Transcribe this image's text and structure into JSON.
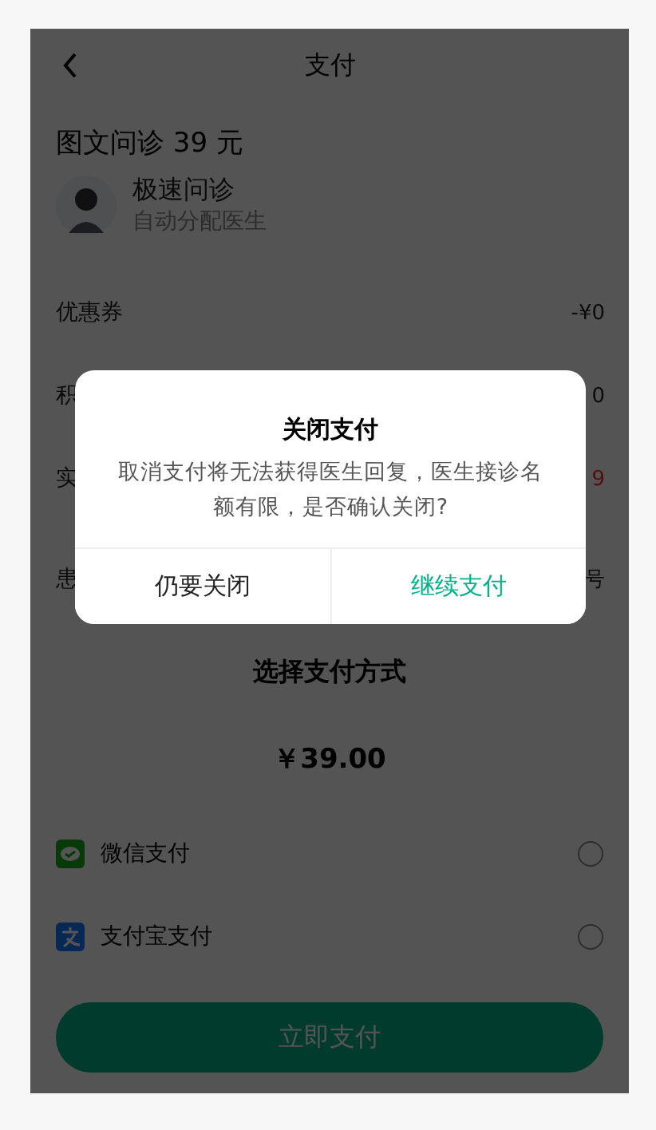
{
  "nav": {
    "title": "支付"
  },
  "service": {
    "title": "图文问诊 39 元",
    "name": "极速问诊",
    "subtitle": "自动分配医生"
  },
  "rows": [
    {
      "label": "优惠券",
      "value": "-¥0",
      "kind": "plain"
    },
    {
      "label": "积",
      "value": "0",
      "kind": "plain"
    },
    {
      "label": "实",
      "value": "9",
      "kind": "price"
    },
    {
      "label": "患",
      "value": "号",
      "kind": "plain"
    }
  ],
  "sheet": {
    "title": "选择支付方式",
    "price": "￥39.00",
    "methods": [
      {
        "name": "微信支付",
        "kind": "wechat",
        "selected": false
      },
      {
        "name": "支付宝支付",
        "kind": "alipay",
        "selected": false
      }
    ],
    "button": "立即支付"
  },
  "dialog": {
    "title": "关闭支付",
    "message": "取消支付将无法获得医生回复，医生接诊名额有限，是否确认关闭?",
    "buttons": [
      {
        "label": "仍要关闭",
        "kind": "cancel"
      },
      {
        "label": "继续支付",
        "kind": "confirm"
      }
    ]
  }
}
